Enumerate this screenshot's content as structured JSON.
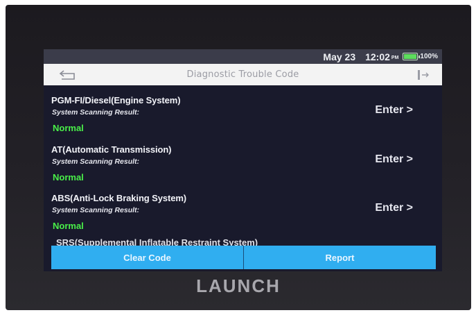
{
  "status_bar": {
    "date": "May 23",
    "time": "12:02",
    "ampm": "PM",
    "battery": "100%",
    "battery_level": 1.0
  },
  "header": {
    "title": "Diagnostic Trouble Code",
    "back_icon": "back-arrow-icon",
    "exit_icon": "exit-icon"
  },
  "systems": [
    {
      "name": "PGM-FI/Diesel(Engine System)",
      "label": "System Scanning Result:",
      "result": "Normal",
      "action": "Enter >"
    },
    {
      "name": "AT(Automatic Transmission)",
      "label": "System Scanning Result:",
      "result": "Normal",
      "action": "Enter >"
    },
    {
      "name": "ABS(Anti-Lock Braking System)",
      "label": "System Scanning Result:",
      "result": "Normal",
      "action": "Enter >"
    }
  ],
  "partial_item": "SRS(Supplemental Inflatable Restraint System)",
  "footer": {
    "clear_code": "Clear Code",
    "report": "Report"
  },
  "brand": "LAUNCH",
  "colors": {
    "screen_bg": "#191a2c",
    "accent": "#30aef0",
    "result_ok": "#49ef49"
  }
}
